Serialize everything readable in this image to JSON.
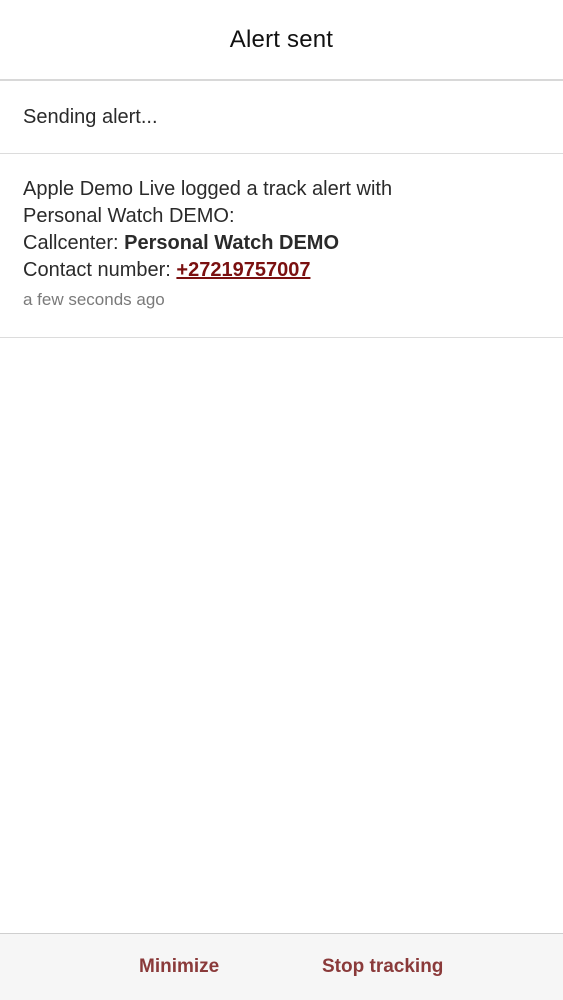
{
  "nav": {
    "title": "Alert sent"
  },
  "status": {
    "text": "Sending alert..."
  },
  "alert": {
    "line1": "Apple Demo Live logged a track alert with",
    "line2": "Personal Watch DEMO:",
    "callcenter_label": "Callcenter: ",
    "callcenter_value": "Personal Watch DEMO",
    "contact_label": "Contact number: ",
    "contact_number": "+27219757007",
    "timestamp": "a few seconds ago"
  },
  "toolbar": {
    "minimize_label": "Minimize",
    "stop_label": "Stop tracking"
  },
  "colors": {
    "accent": "#8a3a3a",
    "link": "#7a1010",
    "divider": "#dcdcdc",
    "toolbar_bg": "#f6f6f6"
  }
}
